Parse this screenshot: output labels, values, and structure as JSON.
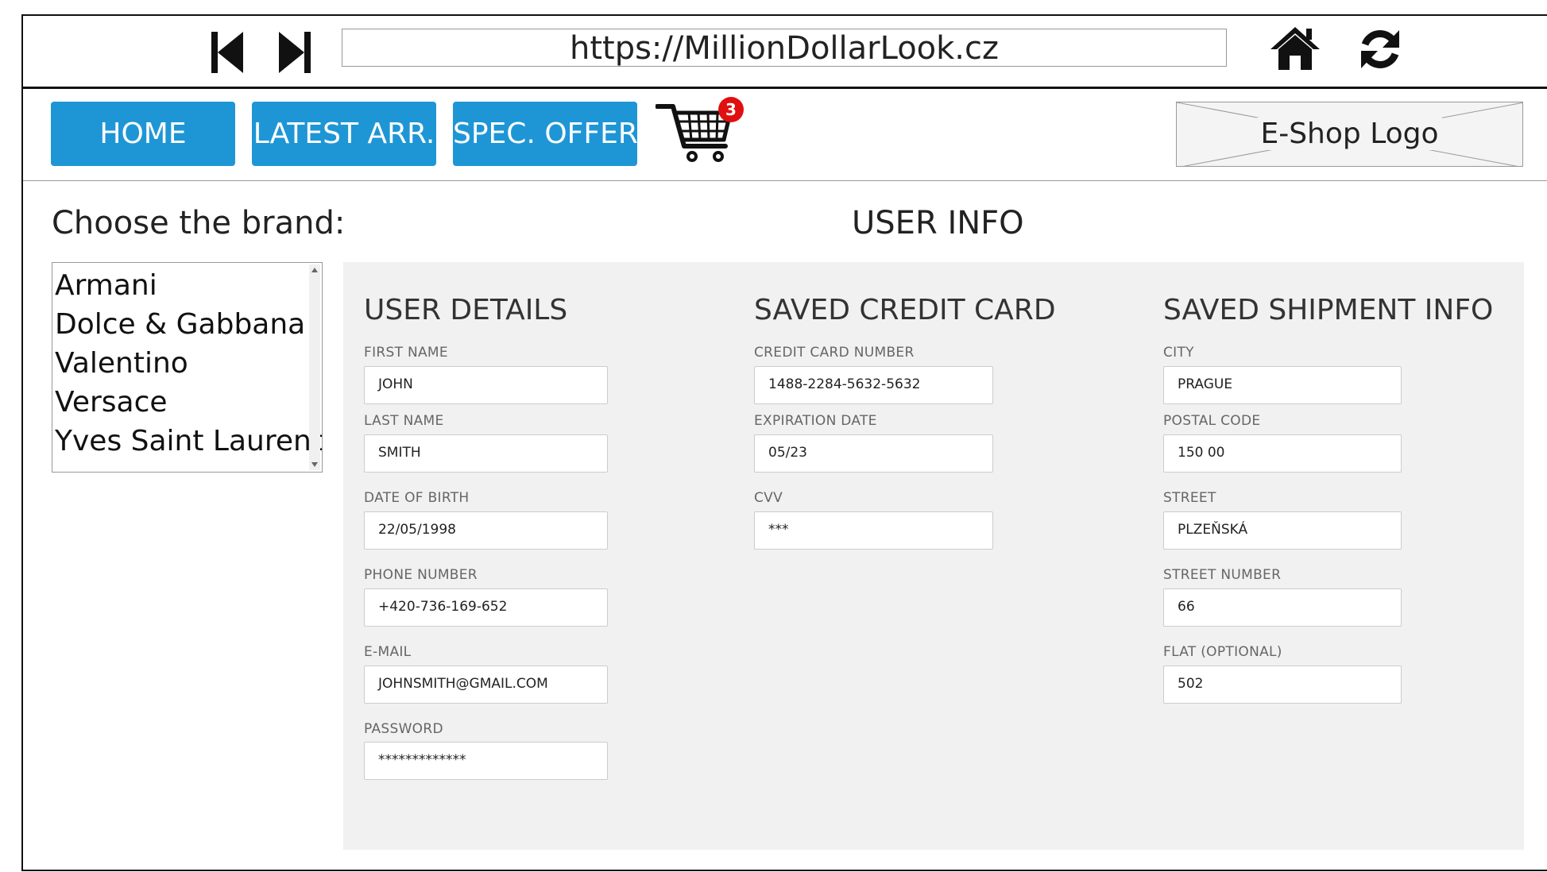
{
  "browser": {
    "url": "https://MillionDollarLook.cz",
    "back_icon": "skip-back-icon",
    "forward_icon": "skip-forward-icon",
    "home_icon": "home-icon",
    "refresh_icon": "refresh-icon"
  },
  "nav": {
    "home": "HOME",
    "latest": "LATEST ARR.",
    "offers": "SPEC. OFFERS",
    "cart_count": "3",
    "cart_icon": "shopping-cart-icon",
    "logo": "E-Shop Logo"
  },
  "brands": {
    "title": "Choose the brand:",
    "items": [
      "Armani",
      "Dolce & Gabbana",
      "Valentino",
      "Versace",
      "Yves Saint Laurent"
    ]
  },
  "page_title": "USER INFO",
  "user_details": {
    "title": "USER DETAILS",
    "first_name_label": "FIRST NAME",
    "first_name": "JOHN",
    "last_name_label": "LAST NAME",
    "last_name": "SMITH",
    "dob_label": "DATE OF BIRTH",
    "dob": "22/05/1998",
    "phone_label": "PHONE NUMBER",
    "phone": "+420-736-169-652",
    "email_label": "E-MAIL",
    "email": "JOHNSMITH@GMAIL.COM",
    "password_label": "PASSWORD",
    "password": "*************"
  },
  "credit_card": {
    "title": "SAVED CREDIT CARD",
    "number_label": "CREDIT CARD NUMBER",
    "number": "1488-2284-5632-5632",
    "expiry_label": "EXPIRATION DATE",
    "expiry": "05/23",
    "cvv_label": "CVV",
    "cvv": "***"
  },
  "shipment": {
    "title": "SAVED SHIPMENT INFO",
    "city_label": "CITY",
    "city": "PRAGUE",
    "postal_label": "POSTAL CODE",
    "postal": "150 00",
    "street_label": "STREET",
    "street": "PLZEŇSKÁ",
    "street_number_label": "STREET NUMBER",
    "street_number": "66",
    "flat_label": "FLAT (OPTIONAL)",
    "flat": "502"
  },
  "colors": {
    "nav_button": "#1e96d6",
    "badge": "#e01010",
    "panel": "#f1f1f1"
  }
}
